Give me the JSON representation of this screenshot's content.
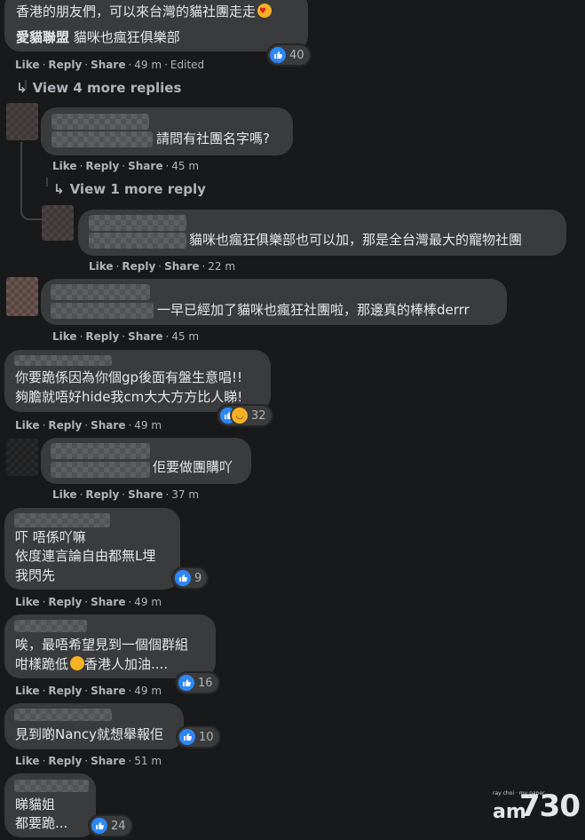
{
  "colors": {
    "background": "#18191a",
    "bubble": "#3a3b3c",
    "text": "#e4e6eb",
    "muted": "#b0b3b8",
    "like_blue": "#2d88ff"
  },
  "actions": {
    "like": "Like",
    "reply": "Reply",
    "share": "Share"
  },
  "comments": [
    {
      "line1": "香港的朋友們，可以來台灣的貓社團走走",
      "author": "愛貓聯盟",
      "line2": "貓咪也瘋狂俱樂部",
      "time": "49 m",
      "edited": "Edited",
      "reaction_count": "40",
      "reaction_icons": [
        "like-icon"
      ]
    },
    {
      "text": "請問有社團名字嗎?",
      "time": "45 m"
    },
    {
      "text": "貓咪也瘋狂俱樂部也可以加，那是全台灣最大的寵物社團",
      "time": "22 m"
    },
    {
      "text": "一早已經加了貓咪也瘋狂社團啦，那邊真的棒棒derrr",
      "time": "45 m"
    },
    {
      "line1": "你要跪係因為你個gp後面有盤生意唱!!",
      "line2": "夠膽就唔好hide我cm大大方方比人睇!",
      "time": "49 m",
      "reaction_count": "32",
      "reaction_icons": [
        "like-icon",
        "laugh-icon"
      ]
    },
    {
      "text": "佢要做團購吖",
      "time": "37 m"
    },
    {
      "line1": "吓 唔係吖嘛",
      "line2": "依度連言論自由都無L埋",
      "line3": "我閃先",
      "time": "49 m",
      "reaction_count": "9",
      "reaction_icons": [
        "like-icon"
      ]
    },
    {
      "line1": "唉，最唔希望見到一個個群組",
      "line2": "咁樣跪低",
      "line2b": "香港人加油....",
      "time": "49 m",
      "reaction_count": "16",
      "reaction_icons": [
        "like-icon"
      ]
    },
    {
      "text": "見到啲Nancy就想舉報佢",
      "time": "51 m",
      "reaction_count": "10",
      "reaction_icons": [
        "like-icon"
      ]
    },
    {
      "line1": "睇貓姐",
      "line2": "都要跪...",
      "reaction_count": "24",
      "reaction_icons": [
        "like-icon"
      ]
    }
  ],
  "more_replies": {
    "first": "View 4 more replies",
    "second": "View 1 more reply"
  },
  "logo": {
    "small": "ray choi · my paper",
    "am": "am",
    "num": "730"
  }
}
